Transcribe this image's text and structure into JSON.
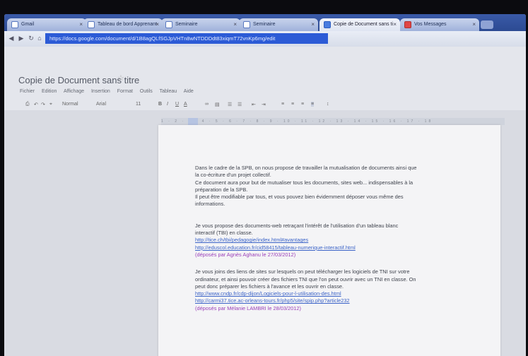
{
  "browser": {
    "tabs": [
      {
        "label": "Gmail",
        "icon": "page-icon",
        "active": false
      },
      {
        "label": "Tableau de bord Apprenant",
        "icon": "page-icon",
        "active": false
      },
      {
        "label": "Seminaire",
        "icon": "page-icon",
        "active": false
      },
      {
        "label": "Seminaire",
        "icon": "page-icon",
        "active": false
      },
      {
        "label": "Copie de Document sans ti",
        "icon": "doc-icon",
        "active": true
      },
      {
        "label": "Vos Messages",
        "icon": "mail-icon",
        "active": false
      }
    ],
    "address": "https://docs.google.com/document/d/1B8agQLfSGJpVHTn8wNTDDDdt83xiqmT72vnKp6mg/edit"
  },
  "docs": {
    "title": "Copie de Document sans titre",
    "menu": [
      "Fichier",
      "Edition",
      "Affichage",
      "Insertion",
      "Format",
      "Outils",
      "Tableau",
      "Aide"
    ],
    "toolbar": {
      "style": "Normal",
      "font": "Arial",
      "size": "11"
    }
  },
  "document": {
    "para1": [
      "Dans le cadre de la SPB, on nous propose de travailler la mutualisation de documents ainsi que",
      "la co-écriture d'un projet collectif.",
      "Ce document aura pour but de mutualiser tous les documents, sites web... indispensables à la",
      "préparation de la SPB.",
      "Il peut être modifiable par tous, et vous pouvez bien évidemment déposer vous même des",
      "informations."
    ],
    "para2": [
      "Je vous propose des documents-web retraçant l'intérêt de l'utilisation d'un tableau blanc",
      "interactif (TBI) en classe."
    ],
    "links2": [
      "http://tice.ch/tbi/pedagogie/index.html#avantages",
      "http://eduscol.education.fr/cid58415/tableau-numerique-interactif.html"
    ],
    "by2": "(déposés par Agnès Aghanu le 27/03/2012)",
    "para3": [
      "Je vous joins des liens de sites sur lesquels on peut télécharger les logiciels de TNI sur votre",
      "ordinateur, et ainsi pouvoir créer des fichiers TNI que l'on peut ouvrir avec un TNI en classe. On",
      "peut donc préparer les fichiers à l'avance et les ouvrir en classe."
    ],
    "links3": [
      "http://www.cndp.fr/cdp-dijon/Logiciels-pour-l-utilisation-des.html",
      "http://carmi37.tice.ac-orleans-tours.fr/php5/site/spip.php?article232"
    ],
    "by3": "(déposés par Mélanie LAMBRI le 28/03/2012)"
  },
  "colors": {
    "tabstrip": "#2c4a92",
    "address_highlight": "#2c5bd6",
    "link": "#3c64c8",
    "author_note": "#9a3fb8"
  }
}
